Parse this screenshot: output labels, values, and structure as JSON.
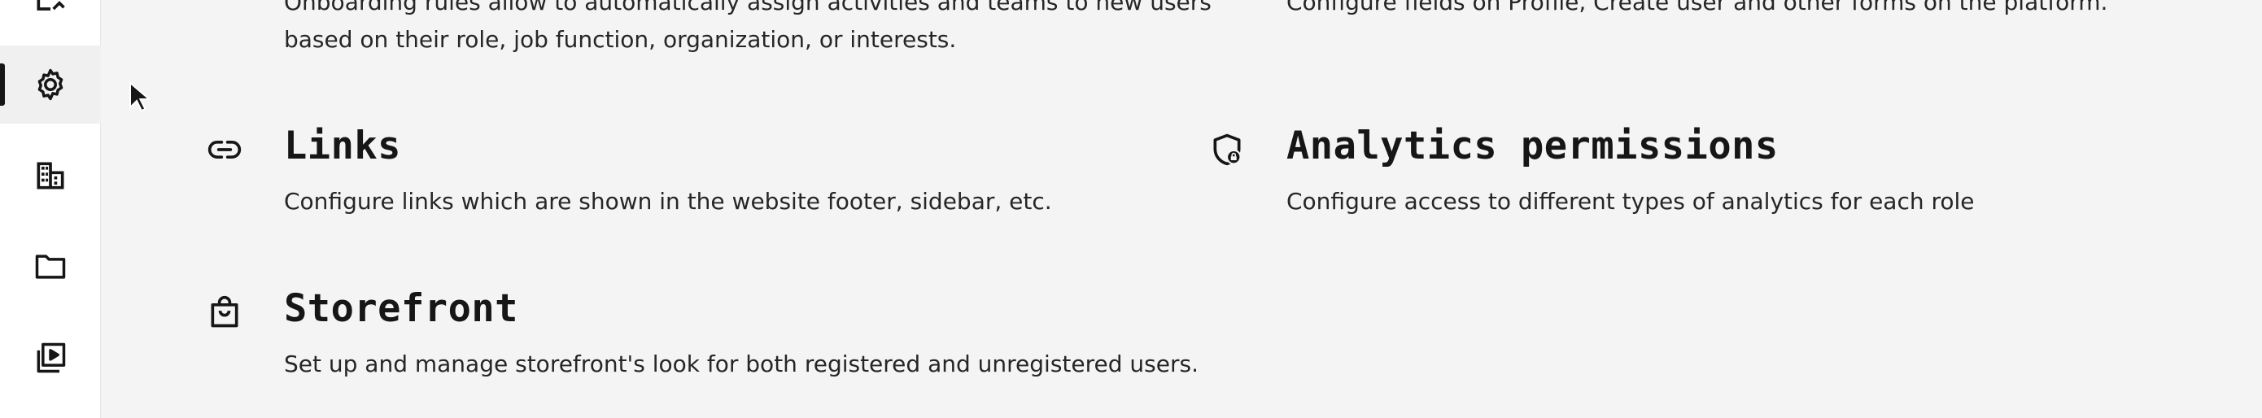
{
  "sidebar": {
    "items": [
      {
        "icon": "partial-icon"
      },
      {
        "icon": "gear-icon",
        "active": true
      },
      {
        "icon": "building-icon"
      },
      {
        "icon": "folder-icon"
      },
      {
        "icon": "video-library-icon"
      }
    ]
  },
  "settings": {
    "onboarding": {
      "desc_line1": "Onboarding rules allow to automatically assign activities and teams to new users",
      "desc_line2": "based on their role, job function, organization, or interests."
    },
    "forms": {
      "desc_line1": "Configure fields on Profile, Create user and other forms on the platform."
    },
    "links": {
      "icon": "link-icon",
      "title": "Links",
      "desc": "Configure links which are shown in the website footer, sidebar, etc."
    },
    "analytics": {
      "icon": "shield-lock-icon",
      "title": "Analytics permissions",
      "desc": "Configure access to different types of analytics for each role"
    },
    "storefront": {
      "icon": "shopping-bag-icon",
      "title": "Storefront",
      "desc": "Set up and manage storefront's look for both registered and unregistered users."
    }
  },
  "colors": {
    "accent": "#161616",
    "background": "#f4f4f4",
    "rail": "#ffffff"
  }
}
